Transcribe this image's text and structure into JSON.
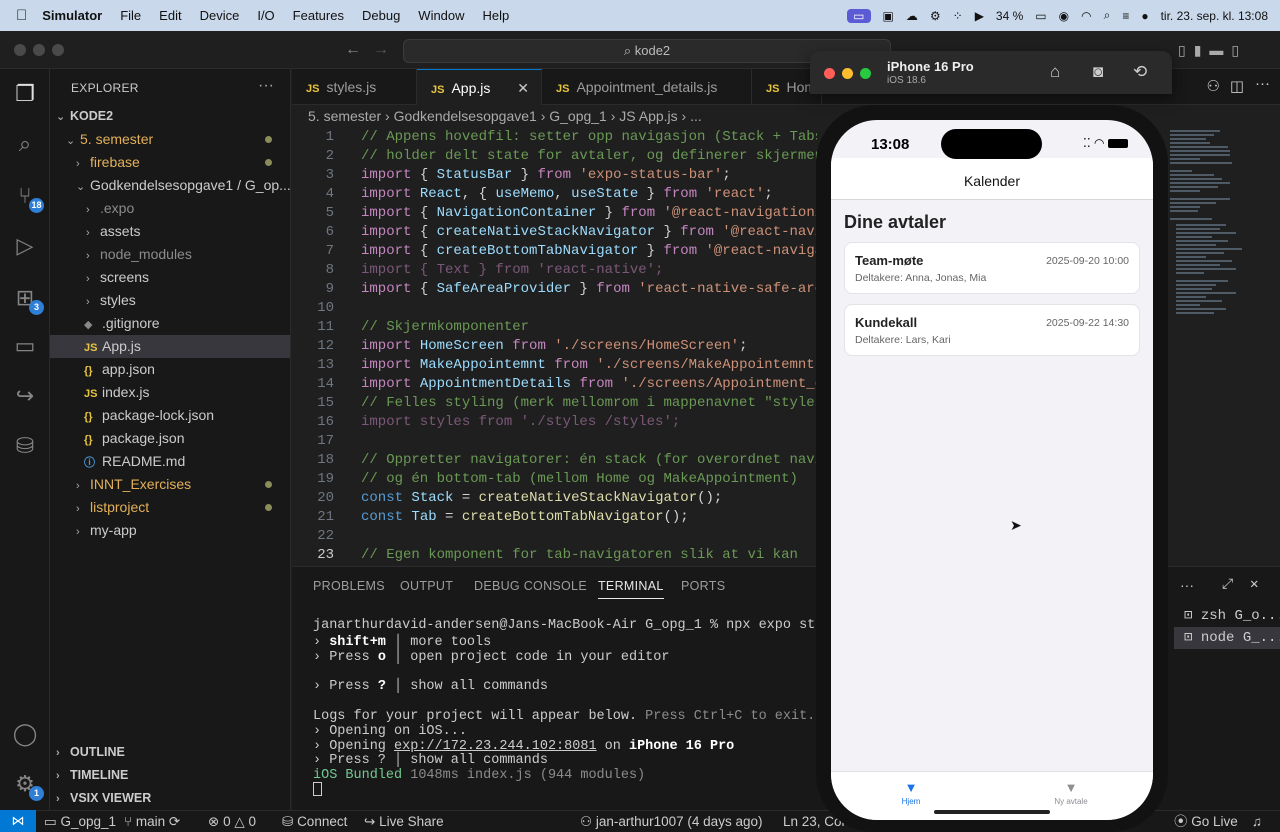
{
  "menubar": {
    "app": "Simulator",
    "items": [
      "File",
      "Edit",
      "Device",
      "I/O",
      "Features",
      "Debug",
      "Window",
      "Help"
    ],
    "battery": "34 %",
    "datetime": "tir. 23. sep. kl. 13:08"
  },
  "titlebar": {
    "search": "kode2"
  },
  "activity": {
    "scm_badge": "18",
    "ext_badge": "3",
    "manage_badge": "1"
  },
  "explorer": {
    "title": "EXPLORER",
    "root": "KODE2",
    "items": [
      {
        "label": "5. semester"
      },
      {
        "label": "firebase"
      },
      {
        "label": "Godkendelsesopgave1 / G_op..."
      },
      {
        "label": ".expo"
      },
      {
        "label": "assets"
      },
      {
        "label": "node_modules"
      },
      {
        "label": "screens"
      },
      {
        "label": "styles"
      },
      {
        "label": ".gitignore"
      },
      {
        "label": "App.js"
      },
      {
        "label": "app.json"
      },
      {
        "label": "index.js"
      },
      {
        "label": "package-lock.json"
      },
      {
        "label": "package.json"
      },
      {
        "label": "README.md"
      },
      {
        "label": "INNT_Exercises"
      },
      {
        "label": "listproject"
      },
      {
        "label": "my-app"
      }
    ],
    "sections": [
      "OUTLINE",
      "TIMELINE",
      "VSIX VIEWER"
    ]
  },
  "tabs": [
    "styles.js",
    "App.js",
    "Appointment_details.js",
    "Hom"
  ],
  "breadcrumb": "5. semester › Godkendelsesopgave1 › G_opg_1 › JS App.js › ...",
  "editor": {
    "lines": [
      "1",
      "2",
      "3",
      "4",
      "5",
      "6",
      "7",
      "8",
      "9",
      "10",
      "11",
      "12",
      "13",
      "14",
      "15",
      "16",
      "17",
      "18",
      "19",
      "20",
      "21",
      "22",
      "23"
    ]
  },
  "panel": {
    "tabs": [
      "PROBLEMS",
      "OUTPUT",
      "DEBUG CONSOLE",
      "TERMINAL",
      "PORTS"
    ],
    "prompt": "janarthurdavid-andersen@Jans-MacBook-Air G_opg_1 % npx expo start",
    "terminals": [
      "zsh  G_o...",
      "node  G_..."
    ]
  },
  "statusbar": {
    "branch_folder": "G_opg_1",
    "branch": "main",
    "problems": "0",
    "warnings": "0",
    "connect": "Connect",
    "liveshare": "Live Share",
    "blame": "jan-arthur1007 (4 days ago)",
    "position": "Ln 23, Col",
    "golive": "Go Live"
  },
  "simulator": {
    "device": "iPhone 16 Pro",
    "os": "iOS 18.6",
    "time": "13:08",
    "header": "Kalender",
    "heading": "Dine avtaler",
    "appointments": [
      {
        "title": "Team-møte",
        "date": "2025-09-20 10:00",
        "participants": "Deltakere: Anna, Jonas, Mia"
      },
      {
        "title": "Kundekall",
        "date": "2025-09-22 14:30",
        "participants": "Deltakere: Lars, Kari"
      }
    ],
    "tabbar": [
      {
        "label": "Hjem"
      },
      {
        "label": "Ny avtale"
      }
    ],
    "colors": {
      "active_tab": "#1a73e8",
      "inactive_tab": "#8e8e93"
    }
  }
}
